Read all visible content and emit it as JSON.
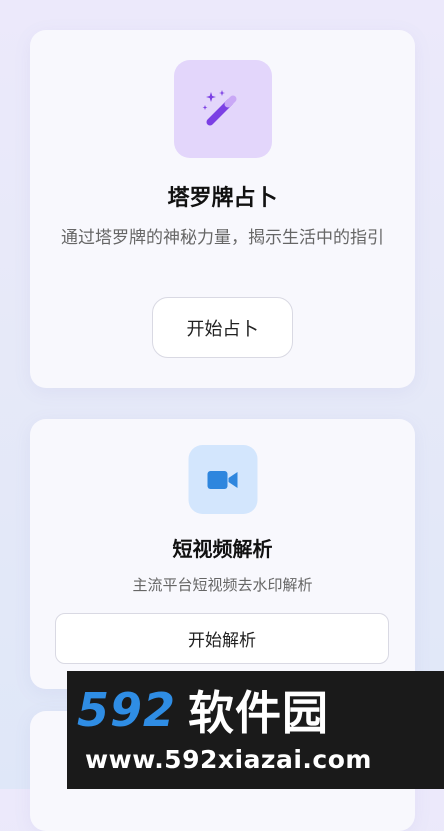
{
  "cards": [
    {
      "icon": "magic-wand-icon",
      "icon_color": "#7b3fe4",
      "tile_color": "#e3d6fb",
      "title": "塔罗牌占卜",
      "description": "通过塔罗牌的神秘力量，揭示生活中的指引",
      "button_label": "开始占卜"
    },
    {
      "icon": "video-camera-icon",
      "icon_color": "#2e86de",
      "tile_color": "#d3e6fd",
      "title": "短视频解析",
      "description": "主流平台短视频去水印解析",
      "button_label": "开始解析"
    }
  ],
  "watermark": {
    "logo_number": "592",
    "logo_text": "软件园",
    "url": "www.592xiazai.com"
  }
}
